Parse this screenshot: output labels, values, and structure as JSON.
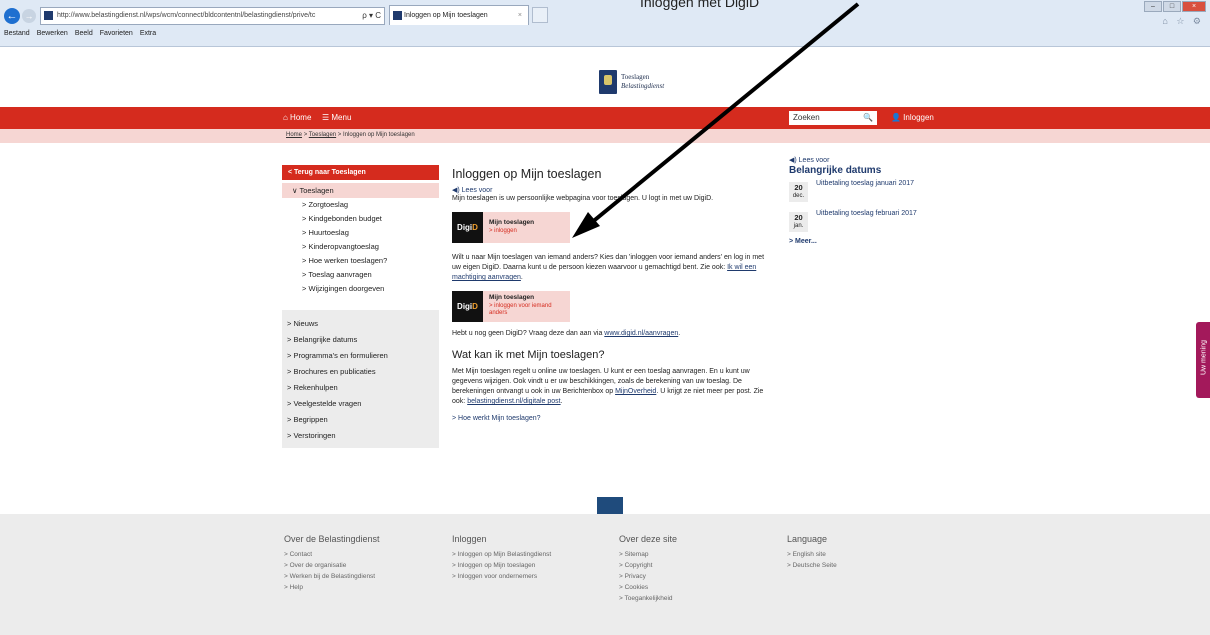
{
  "browser": {
    "address_url": "http://www.belastingdienst.nl/wps/wcm/connect/bldcontentnl/belastingdienst/prive/tc",
    "address_tools": "ρ ▾ C",
    "tab_title": "Inloggen op Mijn toeslagen",
    "tab_close": "×",
    "menu": [
      "Bestand",
      "Bewerken",
      "Beeld",
      "Favorieten",
      "Extra"
    ],
    "back_glyph": "←",
    "forward_glyph": "→",
    "window_controls": [
      "–",
      "□",
      "×"
    ],
    "right_icons": "⌂ ☆ ⚙"
  },
  "logo": {
    "line1": "Toeslagen",
    "line2": "Belastingdienst"
  },
  "topnav": {
    "home": "⌂ Home",
    "menu": "☰ Menu",
    "search_placeholder": "Zoeken",
    "search_icon": "🔍",
    "login": "👤 Inloggen"
  },
  "breadcrumb": {
    "home": "Home",
    "sep": ">",
    "toeslagen": "Toeslagen",
    "current": "Inloggen op Mijn toeslagen"
  },
  "sidebar": {
    "back": "< Terug naar Toeslagen",
    "category": "∨ Toeslagen",
    "sub_items": [
      "> Zorgtoeslag",
      "> Kindgebonden budget",
      "> Huurtoeslag",
      "> Kinderopvangtoeslag",
      "> Hoe werken toeslagen?",
      "> Toeslag aanvragen",
      "> Wijzigingen doorgeven"
    ],
    "nav_items": [
      "> Nieuws",
      "> Belangrijke datums",
      "> Programma's en formulieren",
      "> Brochures en publicaties",
      "> Rekenhulpen",
      "> Veelgestelde vragen",
      "> Begrippen",
      "> Verstoringen"
    ]
  },
  "main": {
    "title": "Inloggen op Mijn toeslagen",
    "lees_voor": "◀) Lees voor",
    "intro": "Mijn toeslagen is uw persoonlijke webpagina voor toeslagen. U logt in met uw DigiD.",
    "digid1": {
      "logo_a": "Digi",
      "logo_b": "D",
      "title": "Mijn toeslagen",
      "action": "> inloggen"
    },
    "machtiging_text": "Wilt u naar Mijn toeslagen van iemand anders? Kies dan 'inloggen voor iemand anders' en log in met uw eigen DigiD. Daarna kunt u de persoon kiezen waarvoor u gemachtigd bent. Zie ook: ",
    "machtiging_link": "Ik wil een machtiging aanvragen",
    "digid2": {
      "logo_a": "Digi",
      "logo_b": "D",
      "title": "Mijn toeslagen",
      "action": "> inloggen voor iemand anders"
    },
    "no_digid_text": "Hebt u nog geen DigiD? Vraag deze dan aan via ",
    "no_digid_link": "www.digid.nl/aanvragen",
    "h2": "Wat kan ik met Mijn toeslagen?",
    "body_text_1": "Met Mijn toeslagen regelt u online uw toeslagen. U kunt er een toeslag aanvragen. En u kunt uw gegevens wijzigen. Ook vindt u er uw beschikkingen, zoals de berekening van uw toeslag. De berekeningen ontvangt u ook in uw Berichtenbox op ",
    "body_link_1": "MijnOverheid",
    "body_text_2": ". U krijgt ze niet meer per post. Zie ook: ",
    "body_link_2": "belastingdienst.nl/digitale post",
    "how_link": "> Hoe werkt Mijn toeslagen?"
  },
  "right": {
    "lees_voor": "◀) Lees voor",
    "title": "Belangrijke datums",
    "dates": [
      {
        "day": "20",
        "month": "dec.",
        "text": "Uitbetaling toeslag januari 2017"
      },
      {
        "day": "20",
        "month": "jan.",
        "text": "Uitbetaling toeslag februari 2017"
      }
    ],
    "more": "> Meer..."
  },
  "feedback": "Uw mening",
  "footer": {
    "columns": [
      {
        "heading": "Over de Belastingdienst",
        "items": [
          "> Contact",
          "> Over de organisatie",
          "> Werken bij de Belastingdienst",
          "> Help"
        ]
      },
      {
        "heading": "Inloggen",
        "items": [
          "> Inloggen op Mijn Belastingdienst",
          "> Inloggen op Mijn toeslagen",
          "> Inloggen voor ondernemers"
        ]
      },
      {
        "heading": "Over deze site",
        "items": [
          "> Sitemap",
          "> Copyright",
          "> Privacy",
          "> Cookies",
          "> Toegankelijkheid"
        ]
      },
      {
        "heading": "Language",
        "items": [
          "> English site",
          "> Deutsche Seite"
        ]
      }
    ]
  },
  "annotation": {
    "text": "Inloggen met DigiD"
  },
  "colors": {
    "brand_red": "#d52b1e",
    "brand_blue": "#1f3a6d",
    "pink": "#f6d6d3",
    "feedback": "#a3195b"
  }
}
